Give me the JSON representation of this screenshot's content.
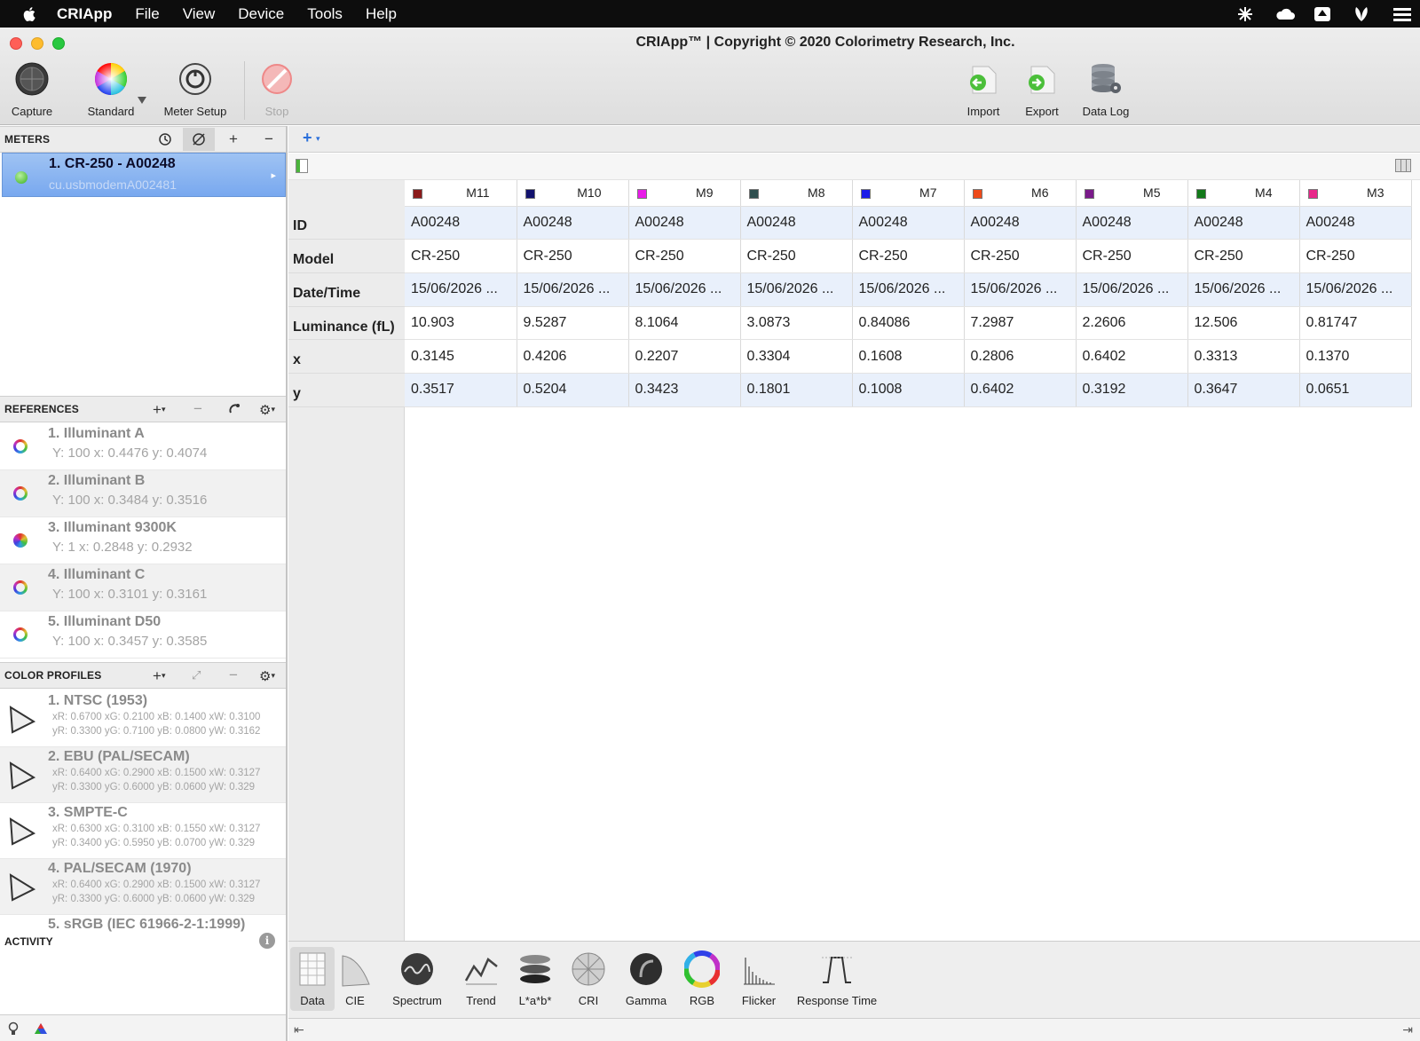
{
  "menubar": {
    "items": [
      "CRIApp",
      "File",
      "View",
      "Device",
      "Tools",
      "Help"
    ]
  },
  "window": {
    "title": "CRIApp™ | Copyright © 2020 Colorimetry Research, Inc."
  },
  "toolbar": {
    "capture": "Capture",
    "standard": "Standard",
    "meter_setup": "Meter Setup",
    "stop": "Stop",
    "import": "Import",
    "export": "Export",
    "data_log": "Data Log"
  },
  "meters": {
    "header": "METERS",
    "selected": {
      "name": "1. CR-250 - A00248",
      "subtitle": "cu.usbmodemA002481"
    }
  },
  "references": {
    "header": "REFERENCES",
    "items": [
      {
        "name": "1. Illuminant A",
        "detail": "Y: 100 x: 0.4476 y: 0.4074"
      },
      {
        "name": "2. Illuminant B",
        "detail": "Y: 100 x: 0.3484 y: 0.3516"
      },
      {
        "name": "3. Illuminant 9300K",
        "detail": "Y: 1 x: 0.2848 y: 0.2932"
      },
      {
        "name": "4. Illuminant C",
        "detail": "Y: 100 x: 0.3101 y: 0.3161"
      },
      {
        "name": "5. Illuminant D50",
        "detail": "Y: 100 x: 0.3457 y: 0.3585"
      }
    ]
  },
  "color_profiles": {
    "header": "COLOR PROFILES",
    "items": [
      {
        "name": "1. NTSC (1953)",
        "line1": "xR: 0.6700 xG: 0.2100 xB: 0.1400 xW: 0.3100",
        "line2": "yR: 0.3300 yG: 0.7100 yB: 0.0800 yW: 0.3162"
      },
      {
        "name": "2. EBU (PAL/SECAM)",
        "line1": "xR: 0.6400 xG: 0.2900 xB: 0.1500 xW: 0.3127",
        "line2": "yR: 0.3300 yG: 0.6000 yB: 0.0600 yW: 0.329"
      },
      {
        "name": "3. SMPTE-C",
        "line1": "xR: 0.6300 xG: 0.3100 xB: 0.1550 xW: 0.3127",
        "line2": "yR: 0.3400 yG: 0.5950 yB: 0.0700 yW: 0.329"
      },
      {
        "name": "4. PAL/SECAM (1970)",
        "line1": "xR: 0.6400 xG: 0.2900 xB: 0.1500 xW: 0.3127",
        "line2": "yR: 0.3300 yG: 0.6000 yB: 0.0600 yW: 0.329"
      },
      {
        "name": "5. sRGB (IEC 61966-2-1:1999)",
        "line1": "",
        "line2": ""
      }
    ]
  },
  "activity": {
    "header": "ACTIVITY",
    "info": "i"
  },
  "table": {
    "row_labels": [
      "ID",
      "Model",
      "Date/Time",
      "Luminance (fL)",
      "x",
      "y"
    ],
    "columns": [
      {
        "name": "M11",
        "color": "#8b1a1a",
        "id": "A00248",
        "model": "CR-250",
        "datetime": "15/06/2026 ...",
        "luminance": "10.903",
        "x": "0.3145",
        "y": "0.3517"
      },
      {
        "name": "M10",
        "color": "#12126e",
        "id": "A00248",
        "model": "CR-250",
        "datetime": "15/06/2026 ...",
        "luminance": "9.5287",
        "x": "0.4206",
        "y": "0.5204"
      },
      {
        "name": "M9",
        "color": "#e81ce8",
        "id": "A00248",
        "model": "CR-250",
        "datetime": "15/06/2026 ...",
        "luminance": "8.1064",
        "x": "0.2207",
        "y": "0.3423"
      },
      {
        "name": "M8",
        "color": "#2f4f4f",
        "id": "A00248",
        "model": "CR-250",
        "datetime": "15/06/2026 ...",
        "luminance": "3.0873",
        "x": "0.3304",
        "y": "0.1801"
      },
      {
        "name": "M7",
        "color": "#1c1ce8",
        "id": "A00248",
        "model": "CR-250",
        "datetime": "15/06/2026 ...",
        "luminance": "0.84086",
        "x": "0.1608",
        "y": "0.1008"
      },
      {
        "name": "M6",
        "color": "#ee4a1a",
        "id": "A00248",
        "model": "CR-250",
        "datetime": "15/06/2026 ...",
        "luminance": "7.2987",
        "x": "0.2806",
        "y": "0.6402"
      },
      {
        "name": "M5",
        "color": "#7a1a8a",
        "id": "A00248",
        "model": "CR-250",
        "datetime": "15/06/2026 ...",
        "luminance": "2.2606",
        "x": "0.6402",
        "y": "0.3192"
      },
      {
        "name": "M4",
        "color": "#127a1a",
        "id": "A00248",
        "model": "CR-250",
        "datetime": "15/06/2026 ...",
        "luminance": "12.506",
        "x": "0.3313",
        "y": "0.3647"
      },
      {
        "name": "M3",
        "color": "#e8288a",
        "id": "A00248",
        "model": "CR-250",
        "datetime": "15/06/2026 ...",
        "luminance": "0.81747",
        "x": "0.1370",
        "y": "0.0651"
      }
    ]
  },
  "tabs": [
    "Data",
    "CIE",
    "Spectrum",
    "Trend",
    "L*a*b*",
    "CRI",
    "Gamma",
    "RGB",
    "Flicker",
    "Response Time"
  ]
}
